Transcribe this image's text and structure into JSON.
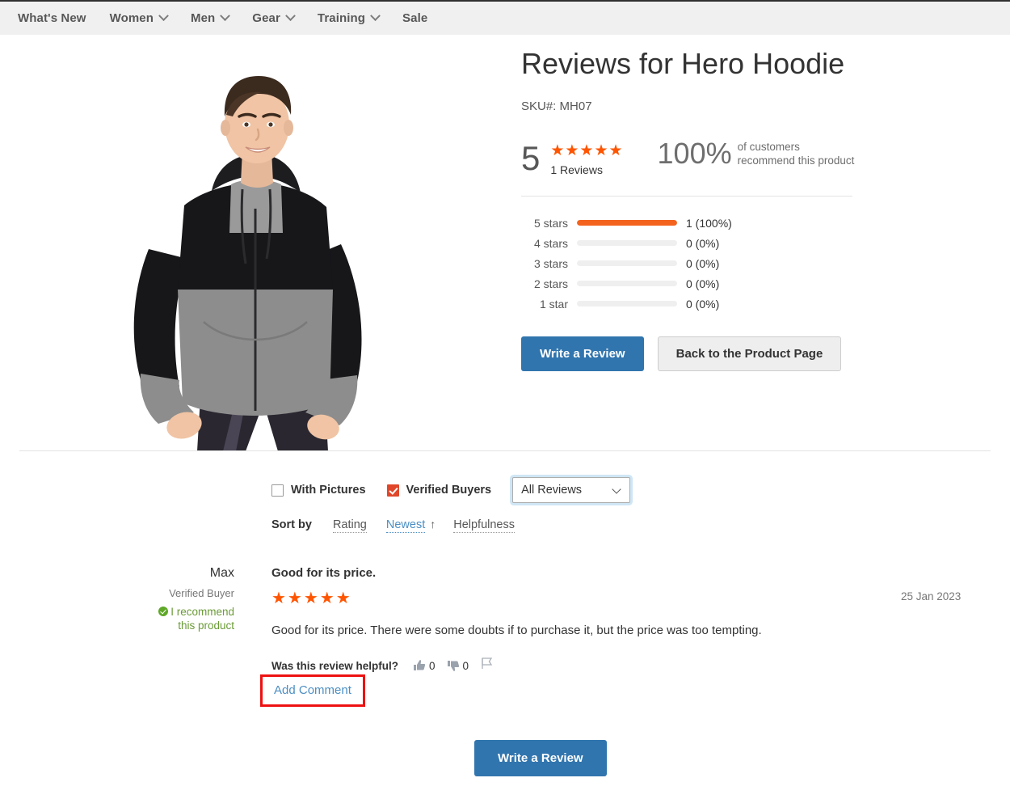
{
  "nav": {
    "items": [
      {
        "label": "What's New",
        "has_caret": false
      },
      {
        "label": "Women",
        "has_caret": true
      },
      {
        "label": "Men",
        "has_caret": true
      },
      {
        "label": "Gear",
        "has_caret": true
      },
      {
        "label": "Training",
        "has_caret": true
      },
      {
        "label": "Sale",
        "has_caret": false
      }
    ]
  },
  "product": {
    "image_alt": "Hero Hoodie worn by male model",
    "title": "Reviews for Hero Hoodie",
    "sku_label": "SKU#:",
    "sku_value": "MH07"
  },
  "summary": {
    "average": "5",
    "stars_filled": 5,
    "stars_glyph": "★★★★★",
    "reviews_count_label": "1 Reviews",
    "recommend_percent": "100%",
    "recommend_line1": "of customers",
    "recommend_line2": "recommend this product"
  },
  "breakdown": {
    "rows": [
      {
        "label": "5 stars",
        "percent": 100,
        "value": "1 (100%)"
      },
      {
        "label": "4 stars",
        "percent": 0,
        "value": "0 (0%)"
      },
      {
        "label": "3 stars",
        "percent": 0,
        "value": "0 (0%)"
      },
      {
        "label": "2 stars",
        "percent": 0,
        "value": "0 (0%)"
      },
      {
        "label": "1 star",
        "percent": 0,
        "value": "0 (0%)"
      }
    ]
  },
  "actions": {
    "write_review": "Write a Review",
    "back_to_product": "Back to the Product Page",
    "write_review_bottom": "Write a Review"
  },
  "filters": {
    "with_pictures": {
      "label": "With Pictures",
      "checked": false
    },
    "verified_buyers": {
      "label": "Verified Buyers",
      "checked": true
    },
    "review_select": {
      "value": "All Reviews",
      "options": [
        "All Reviews"
      ]
    }
  },
  "sort": {
    "title": "Sort by",
    "options": [
      {
        "label": "Rating",
        "active": false,
        "arrow": ""
      },
      {
        "label": "Newest",
        "active": true,
        "arrow": "↑"
      },
      {
        "label": "Helpfulness",
        "active": false,
        "arrow": ""
      }
    ]
  },
  "review": {
    "author": "Max",
    "verified_badge": "Verified Buyer",
    "recommend_line1": "I recommend",
    "recommend_line2": "this product",
    "title": "Good for its price.",
    "stars_glyph": "★★★★★",
    "rating": 5,
    "text": "Good for its price. There were some doubts if to purchase it, but the price was too tempting.",
    "date": "25 Jan 2023",
    "helpful_question": "Was this review helpful?",
    "thumbs_up_count": "0",
    "thumbs_down_count": "0",
    "add_comment": "Add Comment"
  },
  "colors": {
    "star_orange": "#ff5501",
    "bar_orange": "#f4631e",
    "primary_blue": "#3175ae",
    "link_blue": "#4b8ec4",
    "checkbox_red": "#e0472a",
    "recommend_green": "#6b9b37",
    "highlight_red": "#ee1111"
  }
}
